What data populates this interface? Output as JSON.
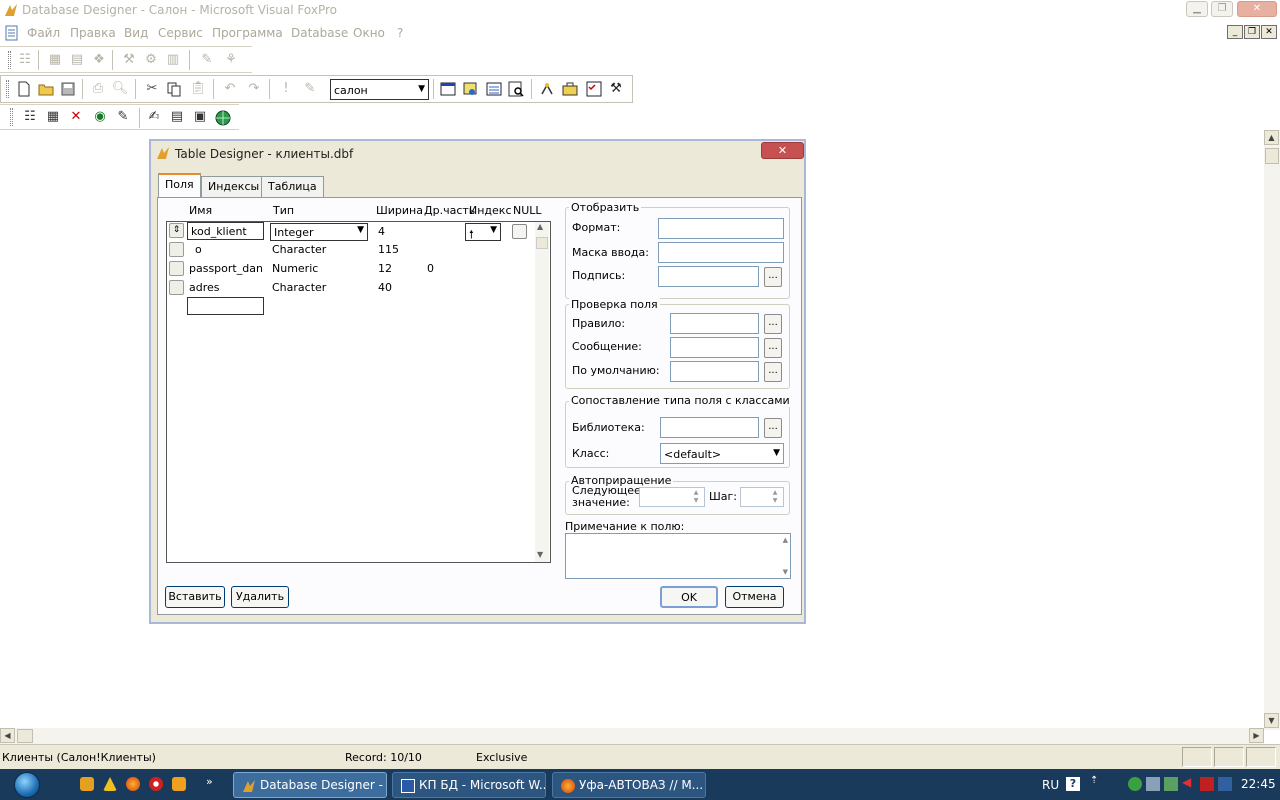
{
  "app": {
    "title": "Database Designer - Салон - Microsoft Visual FoxPro",
    "menu": [
      "Файл",
      "Правка",
      "Вид",
      "Сервис",
      "Программа",
      "Database",
      "Окно",
      "?"
    ]
  },
  "toolbar": {
    "database_combo_value": "салон"
  },
  "dialog": {
    "title": "Table Designer - клиенты.dbf",
    "close_symbol": "✕",
    "tabs": [
      "Поля",
      "Индексы",
      "Таблица"
    ],
    "columns": {
      "name": "Имя",
      "type": "Тип",
      "width": "Ширина",
      "decimal": "Др.часть",
      "index": "Индекс",
      "null": "NULL"
    },
    "fields": [
      {
        "name": "kod_klient",
        "type": "Integer",
        "width": "4",
        "decimal": ""
      },
      {
        "name": "o",
        "type": "Character",
        "width": "115",
        "decimal": ""
      },
      {
        "name": "passport_dan",
        "type": "Numeric",
        "width": "12",
        "decimal": "0"
      },
      {
        "name": "adres",
        "type": "Character",
        "width": "40",
        "decimal": ""
      }
    ],
    "display_group": {
      "label": "Отобразить",
      "format": "Формат:",
      "input_mask": "Маска ввода:",
      "caption": "Подпись:"
    },
    "validation_group": {
      "label": "Проверка поля",
      "rule": "Правило:",
      "message": "Сообщение:",
      "default": "По умолчанию:"
    },
    "mapping_group": {
      "label": "Сопоставление типа поля с классами",
      "library": "Библиотека:",
      "class": "Класс:",
      "class_value": "<default>"
    },
    "autoinc_group": {
      "label": "Автоприращение",
      "next_value": "Следующее значение:",
      "step": "Шаг:"
    },
    "comment_label": "Примечание к полю:",
    "buttons": {
      "insert": "Вставить",
      "delete": "Удалить",
      "ok": "OK",
      "cancel": "Отмена"
    },
    "ellipsis": "..."
  },
  "statusbar": {
    "left": "Клиенты (Салон!Клиенты)",
    "record": "Record: 10/10",
    "mode": "Exclusive"
  },
  "taskbar": {
    "buttons": [
      "Database Designer - ...",
      "КП БД - Microsoft W...",
      "Уфа-АВТОВАЗ // М..."
    ],
    "language": "RU",
    "time": "22:45"
  }
}
